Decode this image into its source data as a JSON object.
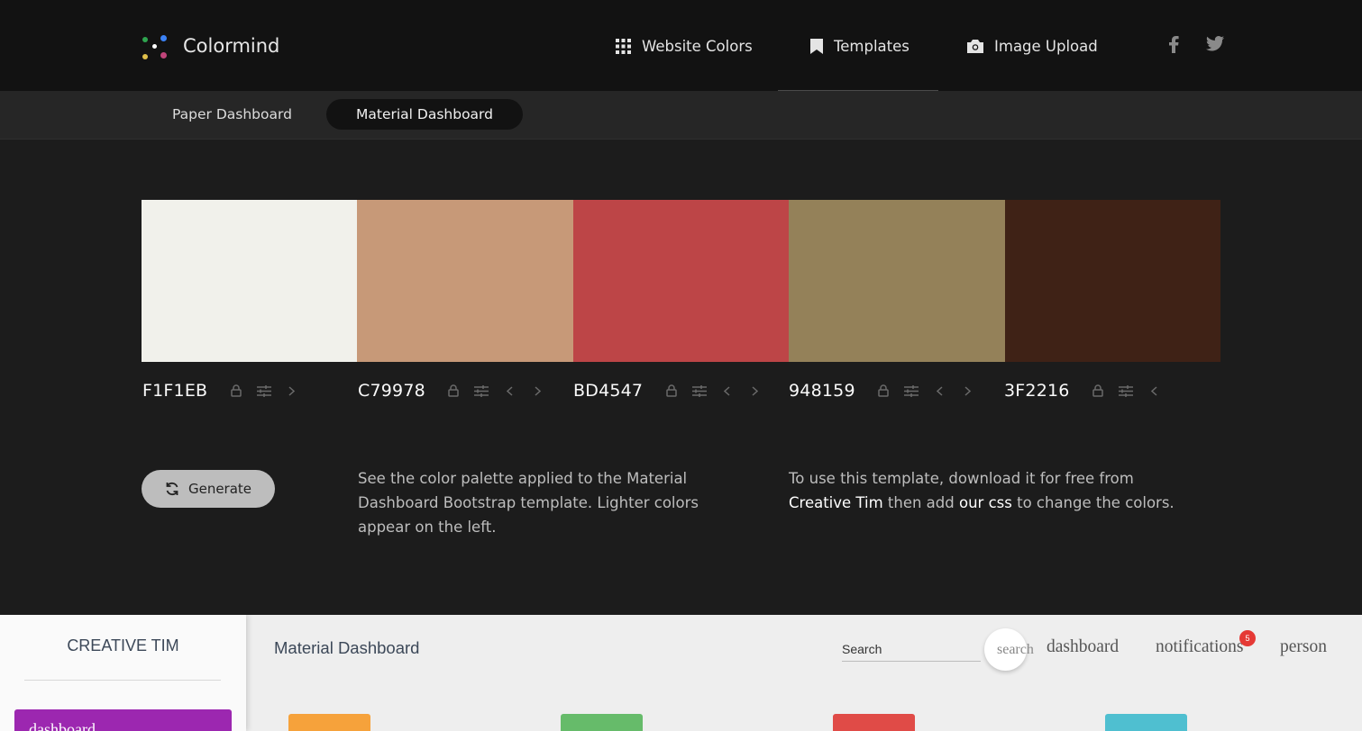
{
  "app": {
    "name": "Colormind",
    "logo_dots": [
      "#2ea44f",
      "#ffffff",
      "#3b82f6",
      "#e0c04a",
      "#c0447a"
    ]
  },
  "nav": {
    "items": [
      {
        "label": "Website Colors",
        "icon": "grid-icon"
      },
      {
        "label": "Templates",
        "icon": "bookmark-icon"
      },
      {
        "label": "Image Upload",
        "icon": "camera-icon"
      }
    ],
    "social": [
      "facebook-icon",
      "twitter-icon"
    ]
  },
  "subnav": {
    "tabs": [
      {
        "label": "Paper Dashboard",
        "active": false
      },
      {
        "label": "Material Dashboard",
        "active": true
      }
    ]
  },
  "palette": [
    {
      "hex": "F1F1EB",
      "color": "#F1F1EB",
      "controls": [
        "lock-icon",
        "adjust-icon",
        "chevron-right-icon"
      ]
    },
    {
      "hex": "C79978",
      "color": "#C79978",
      "controls": [
        "lock-icon",
        "adjust-icon",
        "chevron-left-icon",
        "chevron-right-icon"
      ]
    },
    {
      "hex": "BD4547",
      "color": "#BD4547",
      "controls": [
        "lock-icon",
        "adjust-icon",
        "chevron-left-icon",
        "chevron-right-icon"
      ]
    },
    {
      "hex": "948159",
      "color": "#948159",
      "controls": [
        "lock-icon",
        "adjust-icon",
        "chevron-left-icon",
        "chevron-right-icon"
      ]
    },
    {
      "hex": "3F2216",
      "color": "#3F2216",
      "controls": [
        "lock-icon",
        "adjust-icon",
        "chevron-left-icon"
      ]
    }
  ],
  "generate": {
    "label": "Generate",
    "icon": "refresh-icon"
  },
  "description": {
    "left": "See the color palette applied to the Material Dashboard Bootstrap template. Lighter colors appear on the left.",
    "right_prefix": "To use this template, download it for free from ",
    "right_link1": "Creative Tim",
    "right_middle": " then add ",
    "right_link2": "our css",
    "right_suffix": " to change the colors."
  },
  "preview": {
    "brand": "CREATIVE TIM",
    "title": "Material Dashboard",
    "search_placeholder": "Search",
    "search_button": "search",
    "links": [
      "dashboard",
      "notifications",
      "person"
    ],
    "badge_count": "5",
    "active_item": "dashboard",
    "card_colors": [
      "#f6a23b",
      "#66bb6a",
      "#e04b47",
      "#4fbfd0"
    ],
    "sidebar_active_color": "#9c27b0"
  }
}
